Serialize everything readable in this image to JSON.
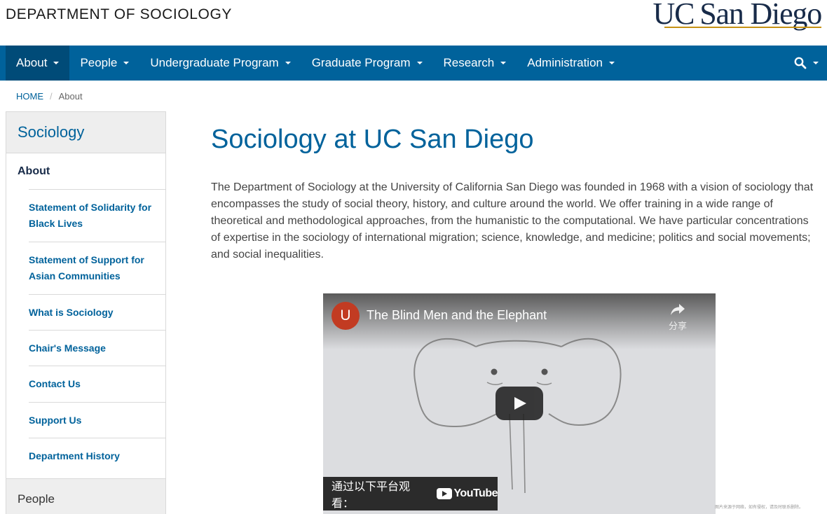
{
  "header": {
    "department": "DEPARTMENT OF SOCIOLOGY",
    "logo_uc": "UC",
    "logo_sd": "San Diego"
  },
  "nav": {
    "items": [
      {
        "label": "About"
      },
      {
        "label": "People"
      },
      {
        "label": "Undergraduate Program"
      },
      {
        "label": "Graduate Program"
      },
      {
        "label": "Research"
      },
      {
        "label": "Administration"
      }
    ]
  },
  "breadcrumb": {
    "home": "HOME",
    "separator": "/",
    "current": "About"
  },
  "sidebar": {
    "title": "Sociology",
    "section": "About",
    "items": [
      {
        "label": "Statement of Solidarity for Black Lives"
      },
      {
        "label": "Statement of Support for Asian Communities"
      },
      {
        "label": "What is Sociology"
      },
      {
        "label": "Chair's Message"
      },
      {
        "label": "Contact Us"
      },
      {
        "label": "Support Us"
      },
      {
        "label": "Department History"
      }
    ],
    "next_section": "People"
  },
  "main": {
    "title": "Sociology at UC San Diego",
    "intro": "The Department of Sociology at the University of California San Diego was founded in 1968 with a vision of sociology that encompasses the study of social theory, history, and culture around the world. We offer training in a wide range of theoretical and methodological approaches, from the humanistic to the computational. We have particular concentrations of expertise in the sociology of international migration; science, knowledge, and medicine; politics and social movements; and social inequalities."
  },
  "video": {
    "channel_initial": "U",
    "title": "The Blind Men and the Elephant",
    "share_label": "分享",
    "watch_on": "通过以下平台观看：",
    "platform": "YouTube"
  },
  "watermark": "图片来源于网络，如有侵权，请及时联系删除。",
  "colors": {
    "nav_bg": "#00629b",
    "nav_active": "#004b78",
    "link": "#00629b",
    "navy": "#182b49",
    "gold": "#c69214"
  }
}
